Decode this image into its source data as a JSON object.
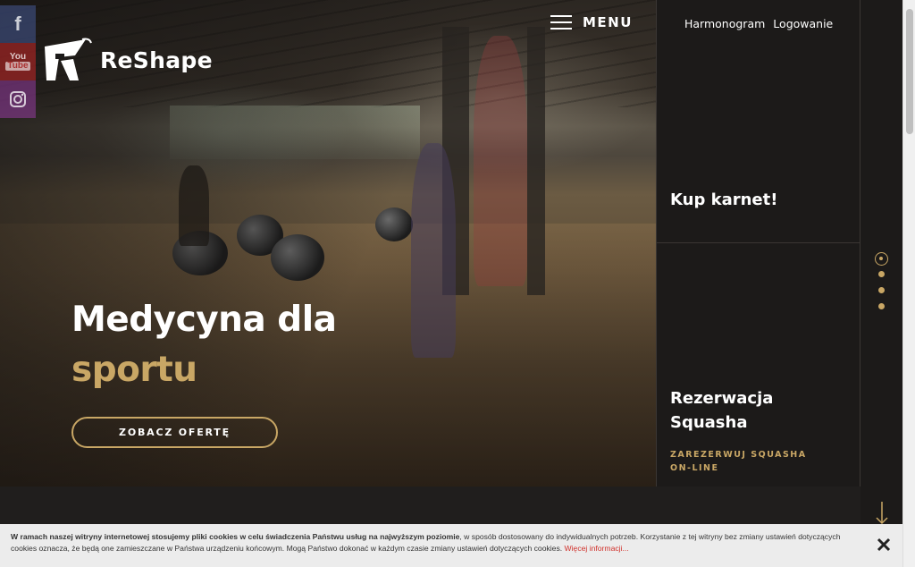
{
  "brand": {
    "name": "ReShape"
  },
  "social": [
    {
      "name": "facebook",
      "glyph": "f"
    },
    {
      "name": "youtube",
      "glyph_top": "You",
      "glyph_bottom": "Tube"
    },
    {
      "name": "instagram"
    }
  ],
  "menu": {
    "label": "MENU"
  },
  "top_links": [
    "Harmonogram",
    "Logowanie"
  ],
  "hero": {
    "title_line1": "Medycyna dla",
    "title_line2": "sportu",
    "cta_label": "ZOBACZ OFERTĘ"
  },
  "panels": [
    {
      "title": "Kup karnet!"
    },
    {
      "title": "Rezerwacja Squasha",
      "subtitle": "ZAREZERWUJ SQUASHA ON-LINE"
    }
  ],
  "slider": {
    "count": 4,
    "active": 1
  },
  "cookie": {
    "bold": "W ramach naszej witryny internetowej stosujemy pliki cookies w celu świadczenia Państwu usług na najwyższym poziomie",
    "text": ", w sposób dostosowany do indywidualnych potrzeb. Korzystanie z tej witryny bez zmiany ustawień dotyczących cookies oznacza, że będą one zamieszczane w Państwa urządzeniu końcowym. Mogą Państwo dokonać w każdym czasie zmiany ustawień dotyczących cookies. ",
    "more": "Więcej informacji..."
  },
  "colors": {
    "accent": "#c9a765",
    "dark": "#1c1a19"
  }
}
